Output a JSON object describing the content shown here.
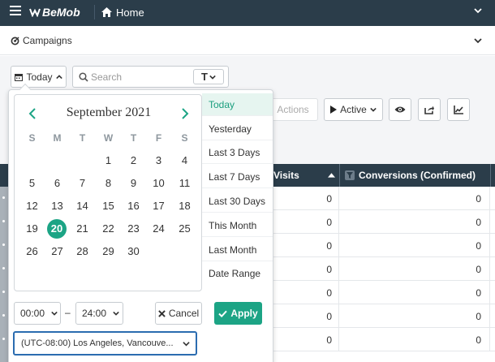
{
  "topbar": {
    "brand": "BeMob",
    "home_label": "Home"
  },
  "campaigns": {
    "title": "Campaigns"
  },
  "toolbar": {
    "today_label": "Today",
    "search_placeholder": "Search",
    "text_filter_glyph": "T",
    "actions_label": "Actions",
    "active_label": "Active"
  },
  "table": {
    "columns": [
      "Visits",
      "Conversions (Confirmed)"
    ],
    "rows": [
      {
        "visits": "0",
        "conversions": "0"
      },
      {
        "visits": "0",
        "conversions": "0"
      },
      {
        "visits": "0",
        "conversions": "0"
      },
      {
        "visits": "0",
        "conversions": "0"
      },
      {
        "visits": "0",
        "conversions": "0"
      },
      {
        "visits": "0",
        "conversions": "0"
      },
      {
        "visits": "0",
        "conversions": "0"
      }
    ]
  },
  "datepicker": {
    "month_title": "September 2021",
    "weekdays": [
      "S",
      "M",
      "T",
      "W",
      "T",
      "F",
      "S"
    ],
    "weeks": [
      [
        "",
        "",
        "",
        "1",
        "2",
        "3",
        "4"
      ],
      [
        "5",
        "6",
        "7",
        "8",
        "9",
        "10",
        "11"
      ],
      [
        "12",
        "13",
        "14",
        "15",
        "16",
        "17",
        "18"
      ],
      [
        "19",
        "20",
        "21",
        "22",
        "23",
        "24",
        "25"
      ],
      [
        "26",
        "27",
        "28",
        "29",
        "30",
        "",
        ""
      ]
    ],
    "selected_day": "20",
    "ranges": [
      "Today",
      "Yesterday",
      "Last 3 Days",
      "Last 7 Days",
      "Last 30 Days",
      "This Month",
      "Last Month",
      "Date Range"
    ],
    "active_range": "Today",
    "time_from": "00:00",
    "time_separator": "–",
    "time_to": "24:00",
    "cancel_label": "Cancel",
    "apply_label": "Apply",
    "timezone": "(UTC-08:00) Los Angeles, Vancouve..."
  },
  "colors": {
    "header_bg": "#2b3d4a",
    "accent_green": "#1ca485",
    "focus_blue": "#2b6cb0"
  }
}
